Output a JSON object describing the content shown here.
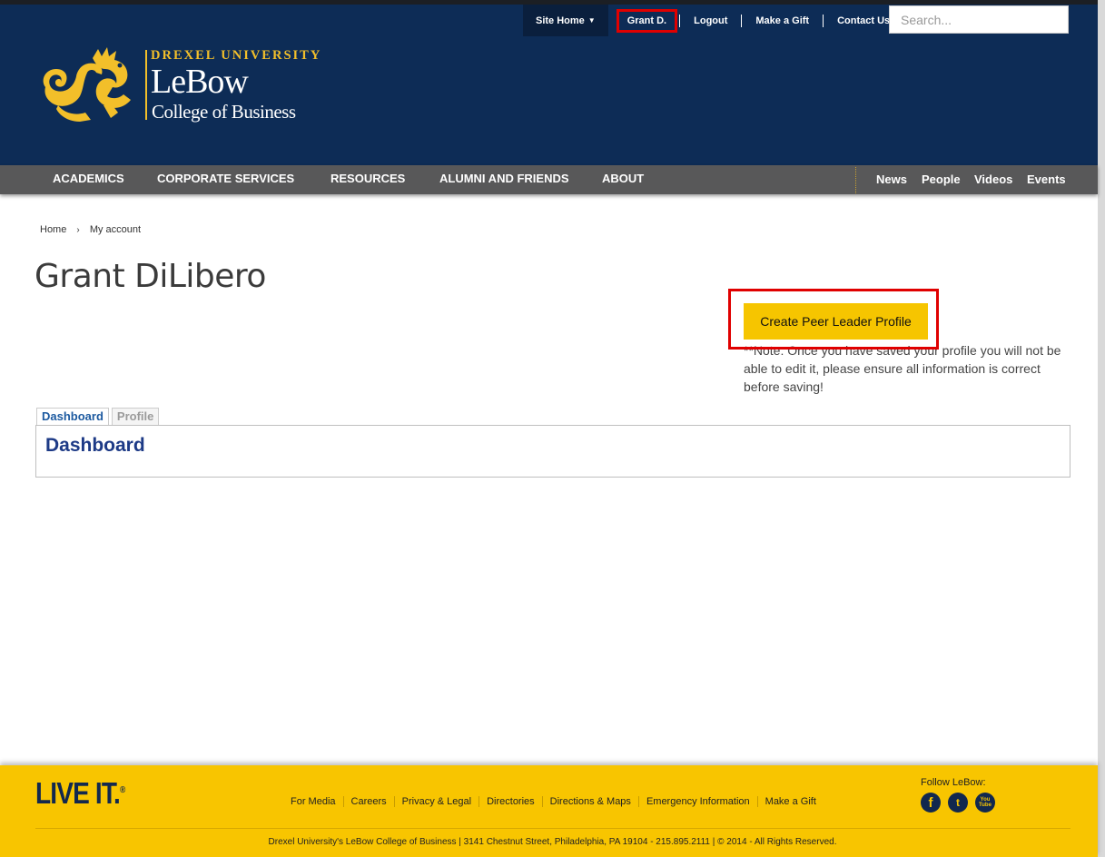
{
  "header": {
    "site_home": "Site Home",
    "user": "Grant D.",
    "links": [
      "Logout",
      "Make a Gift",
      "Contact Us"
    ],
    "search_placeholder": "Search..."
  },
  "logo": {
    "university": "DREXEL UNIVERSITY",
    "name": "LeBow",
    "college": "College of Business"
  },
  "nav": {
    "primary": [
      "ACADEMICS",
      "CORPORATE SERVICES",
      "RESOURCES",
      "ALUMNI AND FRIENDS",
      "ABOUT"
    ],
    "secondary": [
      "News",
      "People",
      "Videos",
      "Events"
    ]
  },
  "breadcrumb": [
    "Home",
    "My account"
  ],
  "page": {
    "title": "Grant DiLibero",
    "peer_button": "Create Peer Leader Profile",
    "peer_note": "**Note: Once you have saved your profile you will not be able to edit it, please ensure all information is correct before saving!",
    "tabs": [
      "Dashboard",
      "Profile"
    ],
    "panel_heading": "Dashboard"
  },
  "footer": {
    "brand": "LIVE IT.",
    "brand_mark": "®",
    "links": [
      "For Media",
      "Careers",
      "Privacy & Legal",
      "Directories",
      "Directions & Maps",
      "Emergency Information",
      "Make a Gift"
    ],
    "follow": "Follow LeBow:",
    "social": [
      "facebook-icon",
      "twitter-icon",
      "youtube-icon"
    ],
    "social_glyphs": [
      "f",
      "t",
      "You Tube"
    ],
    "copyright": "Drexel University's LeBow College of Business | 3141 Chestnut Street, Philadelphia, PA 19104 - 215.895.2111 | © 2014 - All Rights Reserved."
  },
  "colors": {
    "header_bg": "#0d2c56",
    "nav_bg": "#585859",
    "gold": "#f6c500",
    "highlight": "#e00000"
  }
}
